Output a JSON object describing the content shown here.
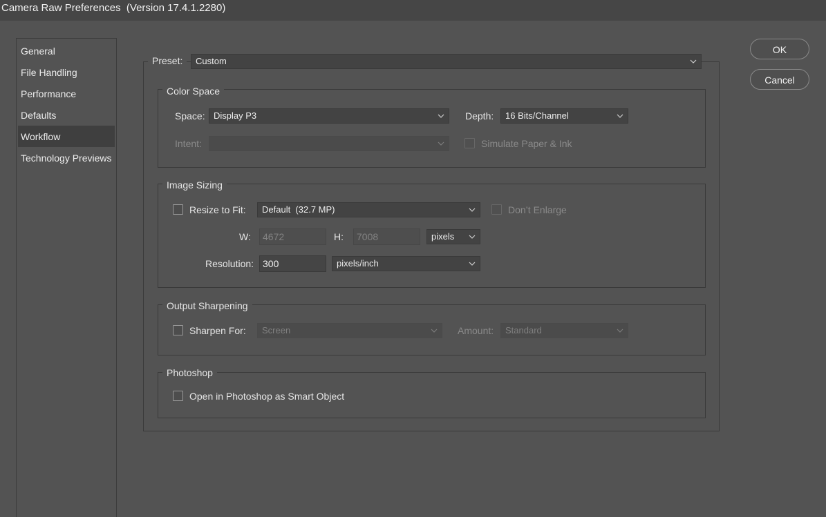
{
  "window": {
    "title": "Camera Raw Preferences  (Version 17.4.1.2280)"
  },
  "sidebar": {
    "items": [
      {
        "label": "General"
      },
      {
        "label": "File Handling"
      },
      {
        "label": "Performance"
      },
      {
        "label": "Defaults"
      },
      {
        "label": "Workflow",
        "selected": true
      },
      {
        "label": "Technology Previews"
      }
    ]
  },
  "buttons": {
    "ok": "OK",
    "cancel": "Cancel"
  },
  "preset": {
    "label": "Preset:",
    "value": "Custom"
  },
  "color_space": {
    "title": "Color Space",
    "space_label": "Space:",
    "space_value": "Display P3",
    "depth_label": "Depth:",
    "depth_value": "16 Bits/Channel",
    "intent_label": "Intent:",
    "intent_value": "",
    "simulate_label": "Simulate Paper & Ink"
  },
  "image_sizing": {
    "title": "Image Sizing",
    "resize_label": "Resize to Fit:",
    "resize_value": "Default  (32.7 MP)",
    "dont_enlarge_label": "Don’t Enlarge",
    "w_label": "W:",
    "w_value": "4672",
    "h_label": "H:",
    "h_value": "7008",
    "units_value": "pixels",
    "resolution_label": "Resolution:",
    "resolution_value": "300",
    "resolution_units": "pixels/inch"
  },
  "output_sharpening": {
    "title": "Output Sharpening",
    "sharpen_label": "Sharpen For:",
    "sharpen_value": "Screen",
    "amount_label": "Amount:",
    "amount_value": "Standard"
  },
  "photoshop": {
    "title": "Photoshop",
    "smart_object_label": "Open in Photoshop as Smart Object"
  }
}
